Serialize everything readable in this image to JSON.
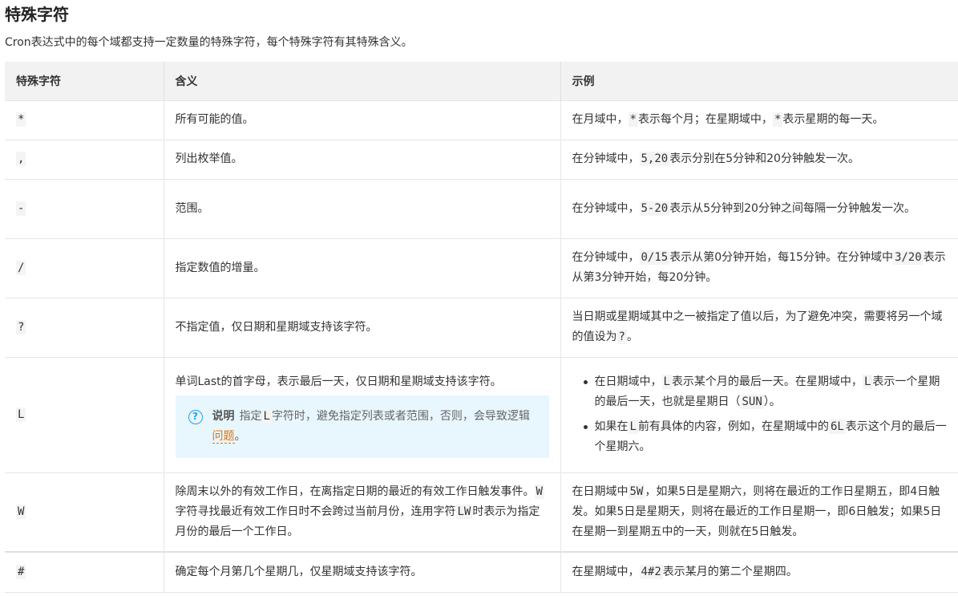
{
  "heading": "特殊字符",
  "intro": "Cron表达式中的每个域都支持一定数量的特殊字符，每个特殊字符有其特殊含义。",
  "table": {
    "headers": [
      "特殊字符",
      "含义",
      "示例"
    ],
    "rows": {
      "star": {
        "char": "*",
        "meaning": "所有可能的值。",
        "example": {
          "p1": "在月域中，",
          "c1": "*",
          "p2": "表示每个月；在星期域中，",
          "c2": "*",
          "p3": "表示星期的每一天。"
        }
      },
      "comma": {
        "char": ",",
        "meaning": "列出枚举值。",
        "example": {
          "p1": "在分钟域中，",
          "c1": "5,20",
          "p2": "表示分别在5分钟和20分钟触发一次。"
        }
      },
      "dash": {
        "char": "-",
        "meaning": "范围。",
        "example": {
          "p1": "在分钟域中，",
          "c1": "5-20",
          "p2": "表示从5分钟到20分钟之间每隔一分钟触发一次。"
        }
      },
      "slash": {
        "char": "/",
        "meaning": "指定数值的增量。",
        "example": {
          "p1": "在分钟域中，",
          "c1": "0/15",
          "p2": "表示从第0分钟开始，每15分钟。在分钟域中",
          "c2": "3/20",
          "p3": "表示从第3分钟开始，每20分钟。"
        }
      },
      "question": {
        "char": "?",
        "meaning": "不指定值，仅日期和星期域支持该字符。",
        "example": {
          "p1": "当日期或星期域其中之一被指定了值以后，为了避免冲突，需要将另一个域的值设为",
          "c1": "?",
          "p2": "。"
        }
      },
      "last": {
        "char": "L",
        "meaning": "单词Last的首字母，表示最后一天，仅日期和星期域支持该字符。",
        "note": {
          "icon": "?",
          "label": "说明",
          "p1": "指定",
          "c1": "L",
          "p2": "字符时，避免指定列表或者范围，否则，会导致逻辑",
          "link": "问题",
          "p3": "。"
        },
        "bullet1": {
          "p1": "在日期域中，",
          "c1": "L",
          "p2": "表示某个月的最后一天。在星期域中，",
          "c2": "L",
          "p3": "表示一个星期的最后一天，也就是星期日（",
          "c3": "SUN",
          "p4": "）。"
        },
        "bullet2": {
          "p1": "如果在",
          "c1": "L",
          "p2": "前有具体的内容，例如，在星期域中的",
          "c2": "6L",
          "p3": "表示这个月的最后一个星期六。"
        }
      },
      "weekday": {
        "char": "W",
        "meaning": {
          "p1": "除周末以外的有效工作日，在离指定日期的最近的有效工作日触发事件。",
          "c1": "W",
          "p2": "字符寻找最近有效工作日时不会跨过当前月份，连用字符",
          "c2": "LW",
          "p3": "时表示为指定月份的最后一个工作日。"
        },
        "example": {
          "p1": "在日期域中",
          "c1": "5W",
          "p2": "，如果5日是星期六，则将在最近的工作日星期五，即4日触发。如果5日是星期天，则将在最近的工作日星期一，即6日触发；如果5日在星期一到星期五中的一天，则就在5日触发。"
        }
      },
      "hash": {
        "char": "#",
        "meaning": "确定每个月第几个星期几，仅星期域支持该字符。",
        "example": {
          "p1": "在星期域中，",
          "c1": "4#2",
          "p2": "表示某月的第二个星期四。"
        }
      }
    }
  }
}
